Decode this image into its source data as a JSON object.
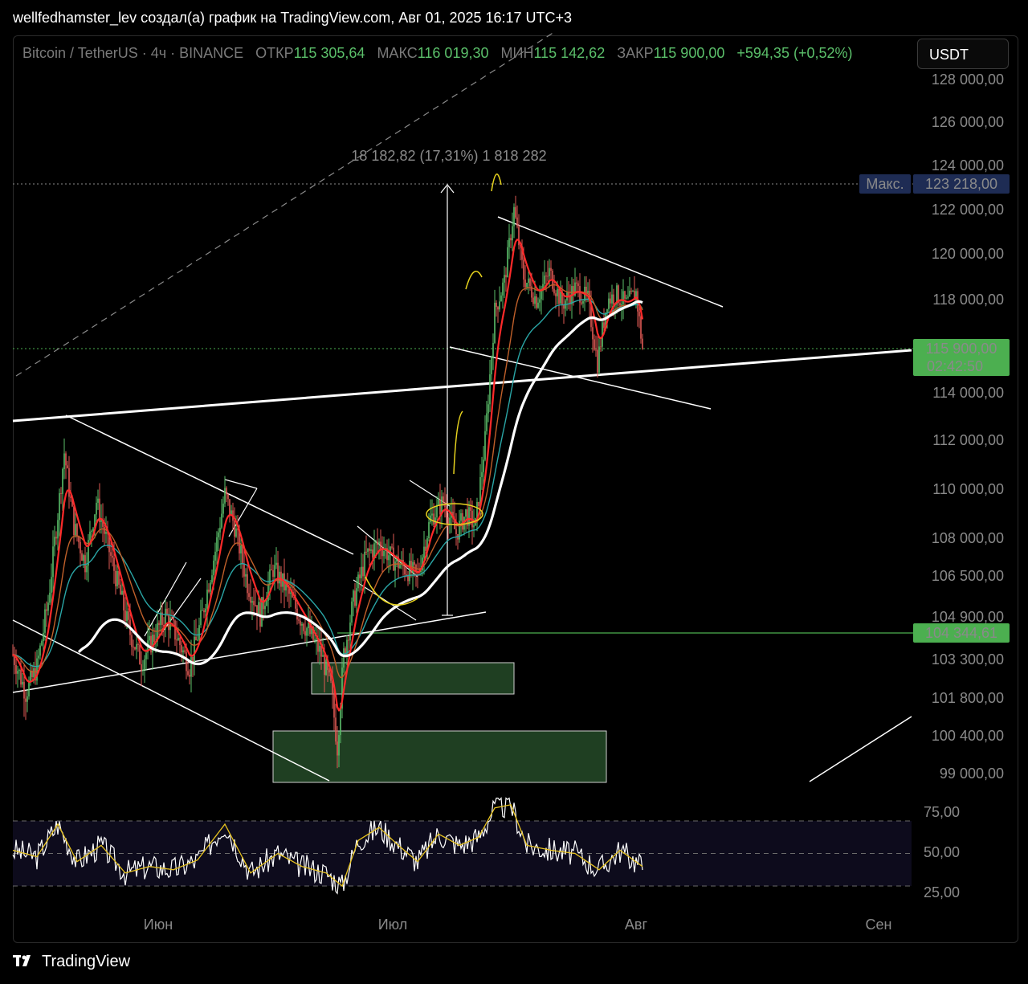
{
  "header": {
    "title": "wellfedhamster_lev создал(а) график на TradingView.com, Авг 01, 2025 16:17 UTC+3"
  },
  "legend": {
    "symbol": "Bitcoin / TetherUS · 4ч · BINANCE",
    "open_label": "ОТКР",
    "open": "115 305,64",
    "high_label": "МАКС",
    "high": "116 019,30",
    "low_label": "МИН",
    "low": "115 142,62",
    "close_label": "ЗАКР",
    "close": "115 900,00",
    "change": "+594,35 (+0,52%)"
  },
  "currency_button": "USDT",
  "footer": {
    "brand": "TradingView"
  },
  "colors": {
    "accent_green": "#4caf50",
    "max_tag": "#1e2c54",
    "candle_up": "#5bbf6a",
    "candle_down": "#e05a55",
    "ema_fast": "#ff2a2a",
    "ema_mid": "#c0602a",
    "ema_slow": "#2aa6a6",
    "ma_long": "#ffffff",
    "annotation": "#e6d21e",
    "rsi_line": "#ffffff",
    "rsi_ma": "#e6c21e",
    "zone_fill": "#1f3f22"
  },
  "chart_data": [
    {
      "type": "candlestick",
      "symbol": "BTC/USDT",
      "timeframe": "4ч",
      "exchange": "BINANCE",
      "y_axis_ticks": [
        "128 000,00",
        "126 000,00",
        "124 000,00",
        "122 000,00",
        "120 000,00",
        "118 000,00",
        "114 000,00",
        "112 000,00",
        "110 000,00",
        "108 000,00",
        "106 500,00",
        "104 900,00",
        "103 300,00",
        "101 800,00",
        "100 400,00",
        "99 000,00"
      ],
      "x_axis_ticks": [
        "Июн",
        "Июл",
        "Авг",
        "Сен"
      ],
      "ylim": [
        98000,
        128500
      ],
      "price_tags": {
        "max_label": "Макс.",
        "max_value": "123 218,00",
        "current_value": "115 900,00",
        "countdown": "02:42:50",
        "level_value": "104 344,61"
      },
      "measure_label": "18 182,82 (17,31%) 1 818 282",
      "path_points": [
        {
          "x": 0,
          "y": 103500
        },
        {
          "x": 8,
          "y": 102000
        },
        {
          "x": 15,
          "y": 103000
        },
        {
          "x": 22,
          "y": 105500
        },
        {
          "x": 28,
          "y": 109000
        },
        {
          "x": 32,
          "y": 111500
        },
        {
          "x": 38,
          "y": 108500
        },
        {
          "x": 45,
          "y": 107000
        },
        {
          "x": 52,
          "y": 109500
        },
        {
          "x": 58,
          "y": 108000
        },
        {
          "x": 66,
          "y": 106000
        },
        {
          "x": 72,
          "y": 104500
        },
        {
          "x": 80,
          "y": 103200
        },
        {
          "x": 88,
          "y": 104200
        },
        {
          "x": 95,
          "y": 105000
        },
        {
          "x": 102,
          "y": 104200
        },
        {
          "x": 110,
          "y": 103000
        },
        {
          "x": 118,
          "y": 105000
        },
        {
          "x": 126,
          "y": 107500
        },
        {
          "x": 132,
          "y": 109800
        },
        {
          "x": 138,
          "y": 108500
        },
        {
          "x": 146,
          "y": 106200
        },
        {
          "x": 154,
          "y": 105000
        },
        {
          "x": 162,
          "y": 106800
        },
        {
          "x": 170,
          "y": 106000
        },
        {
          "x": 178,
          "y": 105000
        },
        {
          "x": 186,
          "y": 104200
        },
        {
          "x": 192,
          "y": 103500
        },
        {
          "x": 198,
          "y": 102200
        },
        {
          "x": 202,
          "y": 100000
        },
        {
          "x": 206,
          "y": 103500
        },
        {
          "x": 212,
          "y": 105500
        },
        {
          "x": 220,
          "y": 107300
        },
        {
          "x": 228,
          "y": 107800
        },
        {
          "x": 236,
          "y": 107200
        },
        {
          "x": 244,
          "y": 106800
        },
        {
          "x": 252,
          "y": 106500
        },
        {
          "x": 260,
          "y": 108800
        },
        {
          "x": 268,
          "y": 109500
        },
        {
          "x": 276,
          "y": 108200
        },
        {
          "x": 282,
          "y": 109000
        },
        {
          "x": 288,
          "y": 108500
        },
        {
          "x": 294,
          "y": 112000
        },
        {
          "x": 300,
          "y": 117500
        },
        {
          "x": 306,
          "y": 118800
        },
        {
          "x": 312,
          "y": 122000
        },
        {
          "x": 318,
          "y": 119000
        },
        {
          "x": 326,
          "y": 118000
        },
        {
          "x": 334,
          "y": 119200
        },
        {
          "x": 342,
          "y": 117800
        },
        {
          "x": 350,
          "y": 118500
        },
        {
          "x": 358,
          "y": 118000
        },
        {
          "x": 364,
          "y": 115300
        },
        {
          "x": 370,
          "y": 118000
        },
        {
          "x": 376,
          "y": 118200
        },
        {
          "x": 382,
          "y": 117800
        },
        {
          "x": 388,
          "y": 118300
        },
        {
          "x": 392,
          "y": 115900
        }
      ],
      "overlays": [
        "EMA",
        "EMA",
        "EMA",
        "MA",
        "trendlines",
        "zones"
      ]
    },
    {
      "type": "line",
      "name": "RSI",
      "y_axis_ticks": [
        "75,00",
        "50,00",
        "25,00"
      ],
      "ylim": [
        20,
        85
      ],
      "band": [
        30,
        70
      ],
      "midline": 50,
      "path_points": [
        {
          "x": 0,
          "y": 52
        },
        {
          "x": 15,
          "y": 48
        },
        {
          "x": 28,
          "y": 68
        },
        {
          "x": 40,
          "y": 45
        },
        {
          "x": 55,
          "y": 55
        },
        {
          "x": 70,
          "y": 38
        },
        {
          "x": 85,
          "y": 42
        },
        {
          "x": 100,
          "y": 40
        },
        {
          "x": 115,
          "y": 46
        },
        {
          "x": 132,
          "y": 68
        },
        {
          "x": 148,
          "y": 38
        },
        {
          "x": 165,
          "y": 50
        },
        {
          "x": 180,
          "y": 42
        },
        {
          "x": 195,
          "y": 38
        },
        {
          "x": 205,
          "y": 30
        },
        {
          "x": 215,
          "y": 58
        },
        {
          "x": 228,
          "y": 66
        },
        {
          "x": 240,
          "y": 55
        },
        {
          "x": 252,
          "y": 45
        },
        {
          "x": 265,
          "y": 62
        },
        {
          "x": 278,
          "y": 55
        },
        {
          "x": 290,
          "y": 60
        },
        {
          "x": 300,
          "y": 78
        },
        {
          "x": 310,
          "y": 80
        },
        {
          "x": 320,
          "y": 55
        },
        {
          "x": 335,
          "y": 52
        },
        {
          "x": 350,
          "y": 50
        },
        {
          "x": 365,
          "y": 40
        },
        {
          "x": 378,
          "y": 52
        },
        {
          "x": 392,
          "y": 42
        }
      ]
    }
  ]
}
